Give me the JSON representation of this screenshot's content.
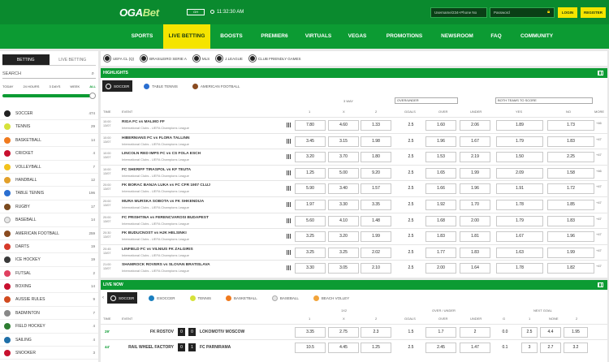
{
  "header": {
    "logo_main": "OGA",
    "logo_bet": "Bet",
    "logo_badge": "GH",
    "clock": "11:32:30 AM",
    "username_placeholder": "Username/234+Phone No",
    "password_placeholder": "Password",
    "login_label": "LOGIN",
    "register_label": "REGISTER"
  },
  "nav": [
    {
      "label": "SPORTS",
      "active": false
    },
    {
      "label": "LIVE BETTING",
      "active": true
    },
    {
      "label": "BOOSTS",
      "active": false
    },
    {
      "label": "PREMIER6",
      "active": false
    },
    {
      "label": "VIRTUALS",
      "active": false
    },
    {
      "label": "VEGAS",
      "active": false
    },
    {
      "label": "PROMOTIONS",
      "active": false
    },
    {
      "label": "NEWSROOM",
      "active": false
    },
    {
      "label": "FAQ",
      "active": false
    },
    {
      "label": "COMMUNITY",
      "active": false
    }
  ],
  "sidebar": {
    "tabs": [
      "BETTING",
      "LIVE BETTING"
    ],
    "search_label": "SEARCH",
    "filters": [
      "TODAY",
      "24 HOURS",
      "3 DAYS",
      "WEEK",
      "ALL"
    ],
    "sports": [
      {
        "name": "SOCCER",
        "count": "474",
        "color": "#222222"
      },
      {
        "name": "TENNIS",
        "count": "29",
        "color": "#d6e23a"
      },
      {
        "name": "BASKETBALL",
        "count": "14",
        "color": "#f07a1e"
      },
      {
        "name": "CRICKET",
        "count": "4",
        "color": "#c8102e"
      },
      {
        "name": "VOLLEYBALL",
        "count": "7",
        "color": "#f2c21c"
      },
      {
        "name": "HANDBALL",
        "count": "12",
        "color": "#e2a02a"
      },
      {
        "name": "TABLE TENNIS",
        "count": "196",
        "color": "#2a6fd1"
      },
      {
        "name": "RUGBY",
        "count": "17",
        "color": "#7a4a1f"
      },
      {
        "name": "BASEBALL",
        "count": "14",
        "color": "#e6e6e6"
      },
      {
        "name": "AMERICAN FOOTBALL",
        "count": "259",
        "color": "#8a4b20"
      },
      {
        "name": "DARTS",
        "count": "19",
        "color": "#d63a2a"
      },
      {
        "name": "ICE HOCKEY",
        "count": "19",
        "color": "#3a3a3a"
      },
      {
        "name": "FUTSAL",
        "count": "2",
        "color": "#e04060"
      },
      {
        "name": "BOXING",
        "count": "14",
        "color": "#c8102e"
      },
      {
        "name": "AUSSIE RULES",
        "count": "9",
        "color": "#d14a1f"
      },
      {
        "name": "BADMINTON",
        "count": "7",
        "color": "#888888"
      },
      {
        "name": "FIELD HOCKEY",
        "count": "4",
        "color": "#2e7d32"
      },
      {
        "name": "SAILING",
        "count": "4",
        "color": "#1f6fa8"
      },
      {
        "name": "SNOOKER",
        "count": "3",
        "color": "#c8102e"
      }
    ]
  },
  "chips": [
    "UEFA CL (Q)",
    "BRASILEIRO SERIE A",
    "MLS",
    "J.LEAGUE",
    "CLUB FRIENDLY GAMES"
  ],
  "highlights": {
    "title": "HIGHLIGHTS",
    "tabs": [
      "SOCCER",
      "TABLE TENNIS",
      "AMERICAN FOOTBALL"
    ],
    "headers": {
      "time": "TIME",
      "event": "EVENT",
      "way": "3 WAY",
      "one": "1",
      "x": "X",
      "two": "2",
      "ou_select": "OVER/UNDER",
      "goals": "GOALS",
      "over": "OVER",
      "under": "UNDER",
      "bts_select": "BOTH TEAMS TO SCORE",
      "yes": "YES",
      "no": "NO",
      "more": "MORE"
    },
    "rows": [
      {
        "date": "10:00",
        "day": "13/07",
        "match": "RIGA FC vs MALMO FF",
        "league": "International Clubs - UEFA Champions League",
        "o1": "7.80",
        "ox": "4.60",
        "o2": "1.33",
        "goals": "2.5",
        "over": "1.60",
        "under": "2.06",
        "yes": "1.89",
        "no": "1.73",
        "more": "+46"
      },
      {
        "date": "10:00",
        "day": "13/07",
        "match": "HIBERNIANS FC vs FLORA TALLINN",
        "league": "International Clubs - UEFA Champions League",
        "o1": "3.45",
        "ox": "3.15",
        "o2": "1.98",
        "goals": "2.5",
        "over": "1.96",
        "under": "1.67",
        "yes": "1.79",
        "no": "1.83",
        "more": "+47"
      },
      {
        "date": "10:00",
        "day": "13/07",
        "match": "LINCOLN RED IMPS FC vs CS FOLA ESCH",
        "league": "International Clubs - UEFA Champions League",
        "o1": "3.20",
        "ox": "3.70",
        "o2": "1.80",
        "goals": "2.5",
        "over": "1.53",
        "under": "2.19",
        "yes": "1.50",
        "no": "2.25",
        "more": "+47"
      },
      {
        "date": "10:00",
        "day": "13/07",
        "match": "FC SHERIFF TIRASPOL vs KF TEUTA",
        "league": "International Clubs - UEFA Champions League",
        "o1": "1.25",
        "ox": "5.00",
        "o2": "9.20",
        "goals": "2.5",
        "over": "1.65",
        "under": "1.99",
        "yes": "2.09",
        "no": "1.58",
        "more": "+46"
      },
      {
        "date": "20:00",
        "day": "13/07",
        "match": "FK BORAC BANJA LUKA vs FC CFR 1907 CLUJ",
        "league": "International Clubs - UEFA Champions League",
        "o1": "5.90",
        "ox": "3.40",
        "o2": "1.57",
        "goals": "2.5",
        "over": "1.66",
        "under": "1.96",
        "yes": "1.91",
        "no": "1.72",
        "more": "+47"
      },
      {
        "date": "20:00",
        "day": "13/07",
        "match": "MURA MURSKA SOBOTA vs FK SHKENDIJA",
        "league": "International Clubs - UEFA Champions League",
        "o1": "1.97",
        "ox": "3.30",
        "o2": "3.35",
        "goals": "2.5",
        "over": "1.92",
        "under": "1.70",
        "yes": "1.78",
        "no": "1.85",
        "more": "+47"
      },
      {
        "date": "20:00",
        "day": "13/07",
        "match": "FC PRISHTINA vs FERENCVAROSI BUDAPEST",
        "league": "International Clubs - UEFA Champions League",
        "o1": "5.60",
        "ox": "4.10",
        "o2": "1.48",
        "goals": "2.5",
        "over": "1.68",
        "under": "2.00",
        "yes": "1.79",
        "no": "1.83",
        "more": "+47"
      },
      {
        "date": "20:30",
        "day": "13/07",
        "match": "FK BUDUCNOST vs HJK HELSINKI",
        "league": "International Clubs - UEFA Champions League",
        "o1": "3.25",
        "ox": "3.20",
        "o2": "1.99",
        "goals": "2.5",
        "over": "1.83",
        "under": "1.81",
        "yes": "1.67",
        "no": "1.96",
        "more": "+47"
      },
      {
        "date": "20:45",
        "day": "13/07",
        "match": "LINFIELD FC vs VILNIUS FK ZALGIRIS",
        "league": "International Clubs - UEFA Champions League",
        "o1": "3.25",
        "ox": "3.25",
        "o2": "2.02",
        "goals": "2.5",
        "over": "1.77",
        "under": "1.83",
        "yes": "1.63",
        "no": "1.99",
        "more": "+47"
      },
      {
        "date": "21:00",
        "day": "13/07",
        "match": "SHAMROCK ROVERS vs SLOVAN BRATISLAVA",
        "league": "International Clubs - UEFA Champions League",
        "o1": "3.30",
        "ox": "3.05",
        "o2": "2.10",
        "goals": "2.5",
        "over": "2.00",
        "under": "1.64",
        "yes": "1.78",
        "no": "1.82",
        "more": "+47"
      }
    ]
  },
  "live_now": {
    "title": "LIVE NOW",
    "tabs": [
      "SOCCER",
      "ESOCCER",
      "TENNIS",
      "BASKETBALL",
      "BASEBALL",
      "BEACH VOLLEY"
    ],
    "headers": {
      "time": "TIME",
      "event": "EVENT",
      "x2": "1X2",
      "one": "1",
      "x": "X",
      "two": "2",
      "ou": "OVER / UNDER",
      "goals": "GOALS",
      "over": "OVER",
      "under": "UNDER",
      "next_goal": "NEXT GOAL",
      "g": "G",
      "none": "NONE"
    },
    "rows": [
      {
        "minute": "29'",
        "home": "FK ROSTOV",
        "hs": "0",
        "as": "0",
        "away": "LOKOMOTIV MOSCOW",
        "o1": "3.35",
        "ox": "2.75",
        "o2": "2.3",
        "goals": "1.5",
        "over": "1.7",
        "under": "2",
        "g": "0.0",
        "n1": "2.5",
        "nn": "4.4",
        "n2": "1.95"
      },
      {
        "minute": "44'",
        "home": "RAIL WHEEL FACTORY",
        "hs": "0",
        "as": "1",
        "away": "FC PARNIRAMA",
        "o1": "10.5",
        "ox": "4.45",
        "o2": "1.25",
        "goals": "2.5",
        "over": "2.45",
        "under": "1.47",
        "g": "0.1",
        "n1": "3",
        "nn": "2.7",
        "n2": "3.2"
      }
    ]
  }
}
